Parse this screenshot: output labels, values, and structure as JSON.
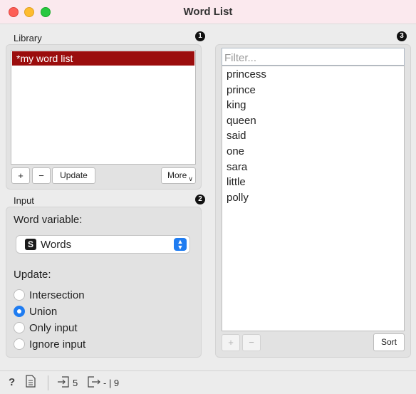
{
  "window": {
    "title": "Word List"
  },
  "library": {
    "label": "Library",
    "badge": "1",
    "items": [
      "*my word list"
    ],
    "add_label": "+",
    "remove_label": "−",
    "update_label": "Update",
    "more_label": "More"
  },
  "input": {
    "label": "Input",
    "badge": "2",
    "word_variable_label": "Word variable:",
    "word_variable_type": "S",
    "word_variable_value": "Words",
    "update_label": "Update:",
    "options": [
      "Intersection",
      "Union",
      "Only input",
      "Ignore input"
    ],
    "selected": "Union"
  },
  "words": {
    "badge": "3",
    "filter_placeholder": "Filter...",
    "items": [
      "princess",
      "prince",
      "king",
      "queen",
      "said",
      "one",
      "sara",
      "little",
      "polly"
    ],
    "add_label": "+",
    "remove_label": "−",
    "sort_label": "Sort"
  },
  "statusbar": {
    "input_count": "5",
    "output_count": "- | 9"
  },
  "colors": {
    "selection": "#9b0d0d",
    "accent": "#1f7cf1",
    "titlebar": "#fbe9ee"
  }
}
